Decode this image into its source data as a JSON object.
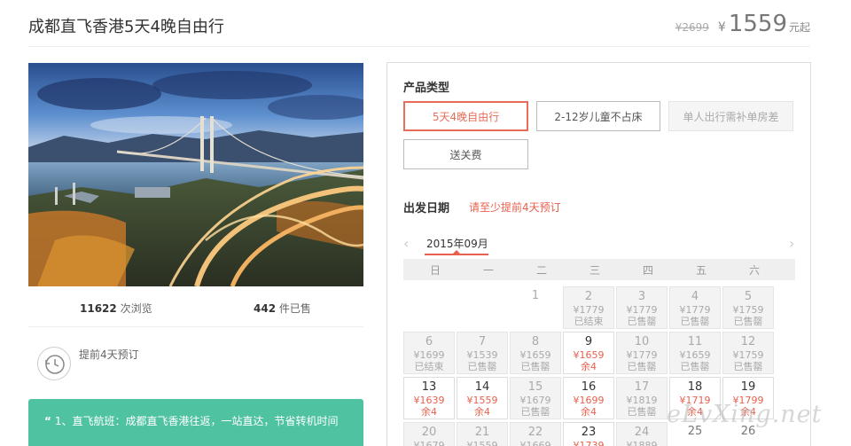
{
  "header": {
    "title": "成都直飞香港5天4晚自由行",
    "old_price": "¥2699",
    "currency": "¥",
    "price": "1559",
    "price_unit": "元起"
  },
  "stats": {
    "views_count": "11622",
    "views_label": "次浏览",
    "sold_count": "442",
    "sold_label": "件已售"
  },
  "advance": {
    "text": "提前4天预订",
    "icon": "clock-icon"
  },
  "features": {
    "quote": "“",
    "text": "1、直飞航班：成都直飞香港往返，一站直达，节省转机时间"
  },
  "product_type": {
    "label": "产品类型",
    "options": [
      {
        "label": "5天4晚自由行",
        "state": "active"
      },
      {
        "label": "2-12岁儿童不占床",
        "state": "normal"
      },
      {
        "label": "单人出行需补单房差",
        "state": "disabled"
      },
      {
        "label": "送关费",
        "state": "normal"
      }
    ]
  },
  "departure": {
    "label": "出发日期",
    "note": "请至少提前4天预订",
    "month": "2015年09月",
    "prev_arrow": "‹",
    "next_arrow": "›",
    "weekdays": [
      "日",
      "一",
      "二",
      "三",
      "四",
      "五",
      "六"
    ],
    "days": [
      {
        "d": "1",
        "col": 2,
        "row": 0,
        "state": "empty",
        "price": "",
        "status": ""
      },
      {
        "d": "2",
        "col": 3,
        "row": 0,
        "state": "past",
        "price": "¥1779",
        "status": "已结束"
      },
      {
        "d": "3",
        "col": 4,
        "row": 0,
        "state": "past",
        "price": "¥1779",
        "status": "已售罄"
      },
      {
        "d": "4",
        "col": 5,
        "row": 0,
        "state": "past",
        "price": "¥1779",
        "status": "已售罄"
      },
      {
        "d": "5",
        "col": 6,
        "row": 0,
        "state": "past",
        "price": "¥1759",
        "status": "已售罄"
      },
      {
        "d": "6",
        "col": 0,
        "row": 1,
        "state": "past",
        "price": "¥1699",
        "status": "已结束"
      },
      {
        "d": "7",
        "col": 1,
        "row": 1,
        "state": "past",
        "price": "¥1539",
        "status": "已售罄"
      },
      {
        "d": "8",
        "col": 2,
        "row": 1,
        "state": "past",
        "price": "¥1659",
        "status": "已售罄"
      },
      {
        "d": "9",
        "col": 3,
        "row": 1,
        "state": "avail",
        "price": "¥1659",
        "status": "余4"
      },
      {
        "d": "10",
        "col": 4,
        "row": 1,
        "state": "past",
        "price": "¥1779",
        "status": "已售罄"
      },
      {
        "d": "11",
        "col": 5,
        "row": 1,
        "state": "past",
        "price": "¥1659",
        "status": "已售罄"
      },
      {
        "d": "12",
        "col": 6,
        "row": 1,
        "state": "past",
        "price": "¥1759",
        "status": "已售罄"
      },
      {
        "d": "13",
        "col": 0,
        "row": 2,
        "state": "avail",
        "price": "¥1639",
        "status": "余4"
      },
      {
        "d": "14",
        "col": 1,
        "row": 2,
        "state": "avail",
        "price": "¥1559",
        "status": "余4"
      },
      {
        "d": "15",
        "col": 2,
        "row": 2,
        "state": "past",
        "price": "¥1679",
        "status": "已售罄"
      },
      {
        "d": "16",
        "col": 3,
        "row": 2,
        "state": "avail",
        "price": "¥1699",
        "status": "余4"
      },
      {
        "d": "17",
        "col": 4,
        "row": 2,
        "state": "past",
        "price": "¥1819",
        "status": "已售罄"
      },
      {
        "d": "18",
        "col": 5,
        "row": 2,
        "state": "avail",
        "price": "¥1719",
        "status": "余4"
      },
      {
        "d": "19",
        "col": 6,
        "row": 2,
        "state": "avail",
        "price": "¥1799",
        "status": "余4"
      },
      {
        "d": "20",
        "col": 0,
        "row": 3,
        "state": "past",
        "price": "¥1679",
        "status": ""
      },
      {
        "d": "21",
        "col": 1,
        "row": 3,
        "state": "past",
        "price": "¥1559",
        "status": ""
      },
      {
        "d": "22",
        "col": 2,
        "row": 3,
        "state": "past",
        "price": "¥1669",
        "status": ""
      },
      {
        "d": "23",
        "col": 3,
        "row": 3,
        "state": "avail",
        "price": "¥1739",
        "status": ""
      },
      {
        "d": "24",
        "col": 4,
        "row": 3,
        "state": "past",
        "price": "¥1889",
        "status": ""
      },
      {
        "d": "25",
        "col": 5,
        "row": 3,
        "state": "plain",
        "price": "",
        "status": ""
      },
      {
        "d": "26",
        "col": 6,
        "row": 3,
        "state": "plain",
        "price": "",
        "status": ""
      }
    ]
  },
  "watermark": "eLvXing.net"
}
